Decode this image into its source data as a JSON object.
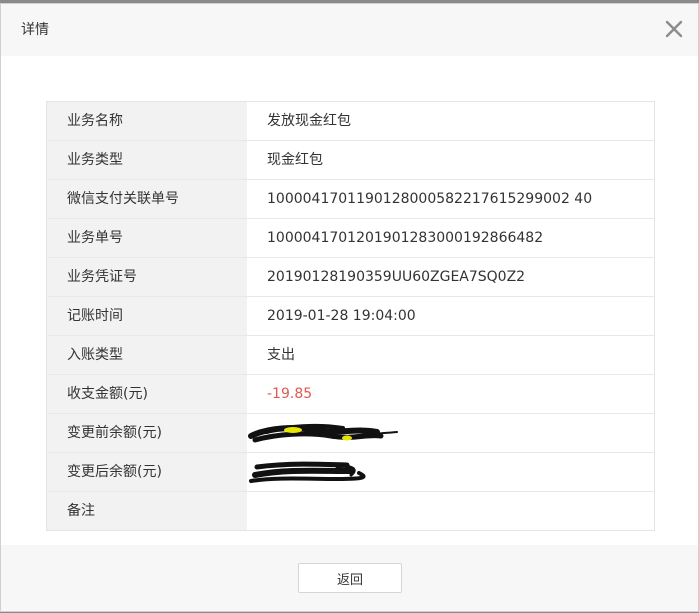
{
  "dialog": {
    "title": "详情",
    "close_icon": "close-icon"
  },
  "details": {
    "rows": [
      {
        "label": "业务名称",
        "value": "发放现金红包"
      },
      {
        "label": "业务类型",
        "value": "现金红包"
      },
      {
        "label": "微信支付关联单号",
        "value": "1000041701190128000582217615299002 40"
      },
      {
        "label": "业务单号",
        "value": "1000041701201901283000192866482"
      },
      {
        "label": "业务凭证号",
        "value": "20190128190359UU60ZGEA7SQ0Z2"
      },
      {
        "label": "记账时间",
        "value": "2019-01-28 19:04:00"
      },
      {
        "label": "入账类型",
        "value": "支出"
      },
      {
        "label": "收支金额(元)",
        "value": "-19.85"
      },
      {
        "label": "变更前余额(元)",
        "value": ""
      },
      {
        "label": "变更后余额(元)",
        "value": ""
      },
      {
        "label": "备注",
        "value": ""
      }
    ]
  },
  "colors": {
    "negative_amount": "#e05a4f",
    "label_bg": "#f2f2f2",
    "redaction_ink": "#111111",
    "redaction_highlight": "#e6e600"
  },
  "footer": {
    "back_label": "返回"
  }
}
